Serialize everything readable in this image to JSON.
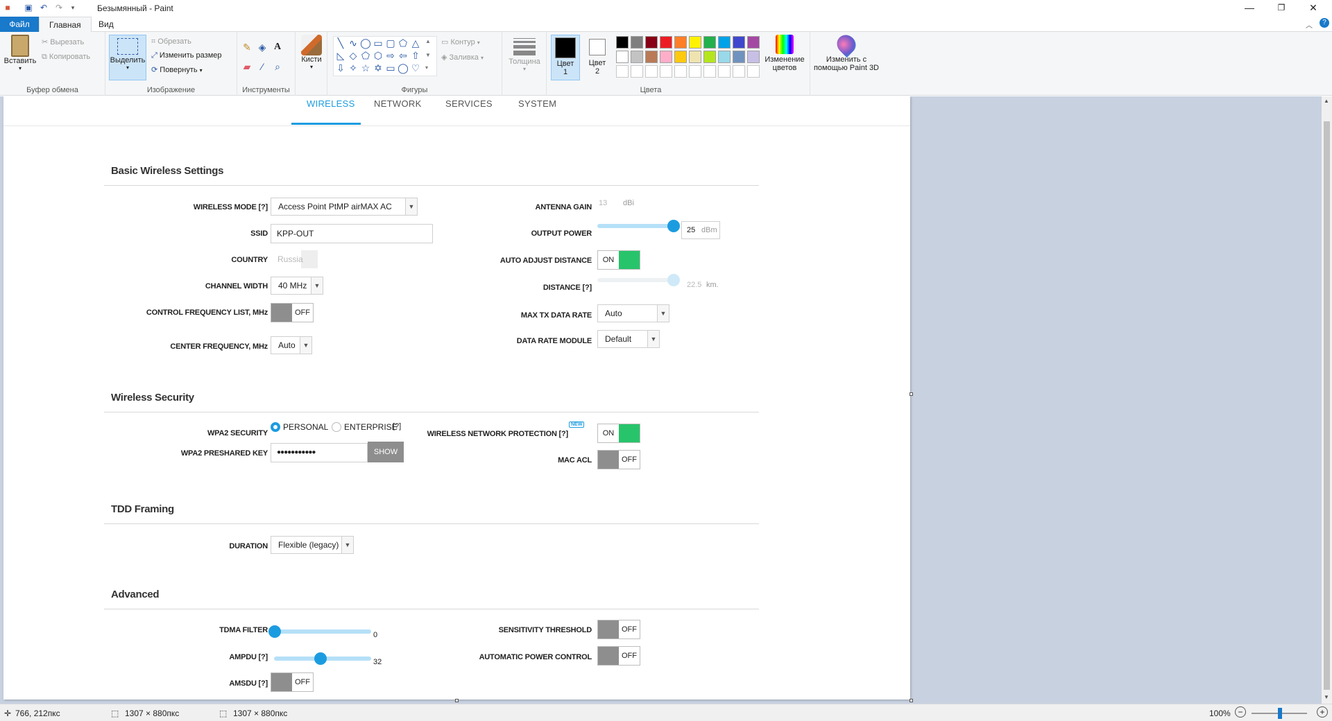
{
  "window": {
    "title": "Безымянный - Paint"
  },
  "ribbon_tabs": [
    "Файл",
    "Главная",
    "Вид"
  ],
  "clipboard": {
    "paste": "Вставить",
    "cut": "Вырезать",
    "copy": "Копировать",
    "group": "Буфер обмена"
  },
  "image": {
    "select": "Выделить",
    "crop": "Обрезать",
    "resize": "Изменить размер",
    "rotate": "Повернуть",
    "group": "Изображение"
  },
  "tools": {
    "group": "Инструменты",
    "brushes": "Кисти"
  },
  "shapes": {
    "outline": "Контур",
    "fill": "Заливка",
    "group": "Фигуры",
    "thickness": "Толщина"
  },
  "colors": {
    "color1": "Цвет",
    "color1_num": "1",
    "color2": "Цвет",
    "color2_num": "2",
    "edit1": "Изменение",
    "edit2": "цветов",
    "paint3d1": "Изменить с",
    "paint3d2": "помощью Paint 3D",
    "group": "Цвета",
    "palette_row1": [
      "#000000",
      "#7f7f7f",
      "#880015",
      "#ed1c24",
      "#ff7f27",
      "#fff200",
      "#22b14c",
      "#00a2e8",
      "#3f48cc",
      "#a349a4"
    ],
    "palette_row2": [
      "#ffffff",
      "#c3c3c3",
      "#b97a57",
      "#ffaec9",
      "#ffc90e",
      "#efe4b0",
      "#b5e61d",
      "#99d9ea",
      "#7092be",
      "#c8bfe7"
    ]
  },
  "status": {
    "cursor": "766, 212пкс",
    "selection": "1307 × 880пкс",
    "canvas_size": "1307 × 880пкс",
    "zoom": "100%"
  },
  "airos": {
    "tabs": [
      "WIRELESS",
      "NETWORK",
      "SERVICES",
      "SYSTEM"
    ],
    "basic": {
      "title": "Basic Wireless Settings",
      "wireless_mode_label": "WIRELESS MODE [?]",
      "wireless_mode_value": "Access Point PtMP airMAX AC",
      "ssid_label": "SSID",
      "ssid_value": "KPP-OUT",
      "country_label": "COUNTRY",
      "country_value": "Russia",
      "channel_width_label": "CHANNEL WIDTH",
      "channel_width_value": "40 MHz",
      "cfl_label": "CONTROL FREQUENCY LIST, MHz",
      "cfl_toggle": "OFF",
      "center_freq_label": "CENTER FREQUENCY, MHz",
      "center_freq_value": "Auto",
      "antenna_gain_label": "ANTENNA GAIN",
      "antenna_gain_value": "13",
      "antenna_gain_unit": "dBi",
      "output_power_label": "OUTPUT POWER",
      "output_power_value": "25",
      "output_power_unit": "dBm",
      "auto_adjust_label": "AUTO ADJUST DISTANCE",
      "auto_adjust_toggle": "ON",
      "distance_label": "DISTANCE [?]",
      "distance_value": "22.5",
      "distance_unit": "km.",
      "max_tx_label": "MAX TX DATA RATE",
      "max_tx_value": "Auto",
      "data_rate_module_label": "DATA RATE MODULE",
      "data_rate_module_value": "Default"
    },
    "security": {
      "title": "Wireless Security",
      "wpa2_label": "WPA2 SECURITY",
      "personal": "PERSONAL",
      "enterprise": "ENTERPRISE",
      "help": "[?]",
      "psk_label": "WPA2 PRESHARED KEY",
      "psk_value": "●●●●●●●●●●●",
      "show_btn": "SHOW",
      "wnp_label": "WIRELESS NETWORK PROTECTION [?]",
      "wnp_badge": "NEW",
      "wnp_toggle": "ON",
      "mac_acl_label": "MAC ACL",
      "mac_acl_toggle": "OFF"
    },
    "tdd": {
      "title": "TDD Framing",
      "duration_label": "DURATION",
      "duration_value": "Flexible (legacy)"
    },
    "advanced": {
      "title": "Advanced",
      "tdma_label": "TDMA FILTER",
      "tdma_value": "0",
      "ampdu_label": "AMPDU [?]",
      "ampdu_value": "32",
      "amsdu_label": "AMSDU [?]",
      "amsdu_toggle": "OFF",
      "sensitivity_label": "SENSITIVITY THRESHOLD",
      "sensitivity_toggle": "OFF",
      "apc_label": "AUTOMATIC POWER CONTROL",
      "apc_toggle": "OFF"
    }
  }
}
